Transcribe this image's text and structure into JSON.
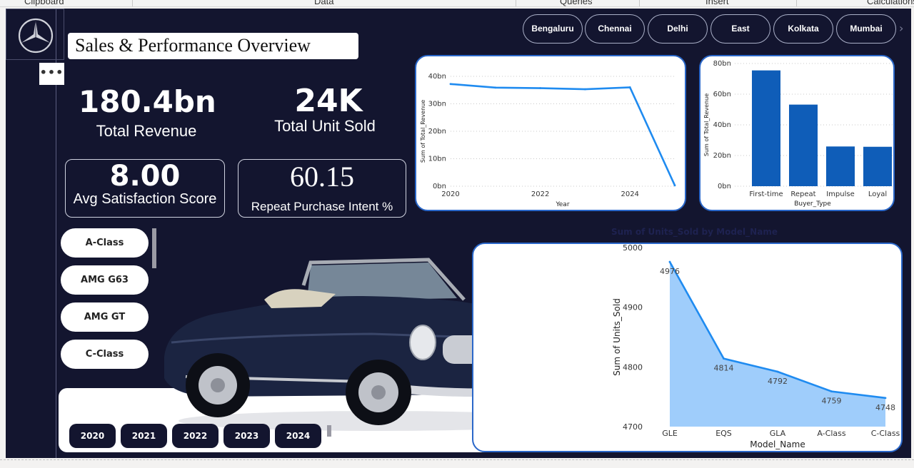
{
  "ribbon": {
    "groups": [
      "Clipboard",
      "Data",
      "Queries",
      "Insert",
      "Calculations"
    ]
  },
  "page": {
    "title": "Sales & Performance Overview",
    "more_label": "•••"
  },
  "city_slicer": {
    "items": [
      "Bengaluru",
      "Chennai",
      "Delhi",
      "East",
      "Kolkata",
      "Mumbai"
    ],
    "more_icon": "chevron-right-icon"
  },
  "kpis": {
    "total_revenue": {
      "value": "180.4bn",
      "label": "Total Revenue"
    },
    "total_units": {
      "value": "24K",
      "label": "Total Unit Sold"
    },
    "avg_satisfaction": {
      "value": "8.00",
      "label": "Avg Satisfaction Score"
    },
    "repeat_intent": {
      "value": "60.15",
      "label": "Repeat Purchase Intent %"
    }
  },
  "model_slicer": {
    "items": [
      "A-Class",
      "AMG G63",
      "AMG GT",
      "C-Class"
    ]
  },
  "year_slicer": {
    "items": [
      "2020",
      "2021",
      "2022",
      "2023",
      "2024"
    ]
  },
  "colors": {
    "canvas_bg": "#13152f",
    "line_blue": "#1f8bf0",
    "bar_blue": "#0f5db8",
    "area_fill": "#9fcdfb",
    "card_border": "#2a67c9"
  },
  "chart_data": [
    {
      "type": "line",
      "title": "",
      "xlabel": "Year",
      "ylabel": "Sum of Total_Revenue",
      "x": [
        2020,
        2021,
        2022,
        2023,
        2024,
        2025
      ],
      "series": [
        {
          "values": [
            37.2,
            35.9,
            35.7,
            35.3,
            36.0,
            0.3
          ]
        }
      ],
      "yticks": [
        "0bn",
        "10bn",
        "20bn",
        "30bn",
        "40bn"
      ],
      "xticks": [
        "2020",
        "2022",
        "2024"
      ],
      "ylim": [
        0,
        40
      ],
      "xlim": [
        2020,
        2025
      ],
      "grid": true
    },
    {
      "type": "bar",
      "title": "",
      "xlabel": "Buyer_Type",
      "ylabel": "Sum of Total_Revenue",
      "categories": [
        "First-time",
        "Repeat",
        "Impulse",
        "Loyal"
      ],
      "values": [
        75.5,
        53.2,
        25.9,
        25.7
      ],
      "yticks": [
        "0bn",
        "20bn",
        "40bn",
        "60bn",
        "80bn"
      ],
      "ylim": [
        0,
        80
      ],
      "grid": true
    },
    {
      "type": "area",
      "title": "Sum of Units_Sold by Model_Name",
      "xlabel": "Model_Name",
      "ylabel": "Sum of Units_Sold",
      "categories": [
        "GLE",
        "EQS",
        "GLA",
        "A-Class",
        "C-Class"
      ],
      "values": [
        4976,
        4814,
        4792,
        4759,
        4748
      ],
      "data_labels": [
        "4976",
        "4814",
        "4792",
        "4759",
        "4748"
      ],
      "yticks": [
        "4700",
        "4800",
        "4900",
        "5000"
      ],
      "ylim": [
        4700,
        5000
      ],
      "grid": false
    }
  ]
}
